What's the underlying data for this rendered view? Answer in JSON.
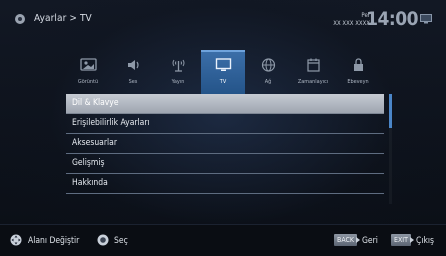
{
  "header": {
    "breadcrumb": "Ayarlar > TV",
    "day": "Per",
    "date": "XX XXX XXXX",
    "time": "14:00",
    "gear_icon": "gear-icon",
    "tv_icon": "tv-icon"
  },
  "tabs": [
    {
      "label": "Görüntü",
      "icon": "picture-icon",
      "active": false
    },
    {
      "label": "Ses",
      "icon": "speaker-icon",
      "active": false
    },
    {
      "label": "Yayın",
      "icon": "antenna-icon",
      "active": false
    },
    {
      "label": "TV",
      "icon": "tv-icon",
      "active": true
    },
    {
      "label": "Ağ",
      "icon": "globe-icon",
      "active": false
    },
    {
      "label": "Zamanlayıcı",
      "icon": "calendar-icon",
      "active": false
    },
    {
      "label": "Ebeveyn",
      "icon": "lock-icon",
      "active": false
    }
  ],
  "menu": {
    "items": [
      {
        "label": "Dil & Klavye",
        "selected": true
      },
      {
        "label": "Erişilebilirlik Ayarları",
        "selected": false
      },
      {
        "label": "Aksesuarlar",
        "selected": false
      },
      {
        "label": "Gelişmiş",
        "selected": false
      },
      {
        "label": "Hakkında",
        "selected": false
      }
    ]
  },
  "footer": {
    "navigate_label": "Alanı Değiştir",
    "ok_label": "Seç",
    "back_key": "BACK",
    "back_label": "Geri",
    "exit_key": "EXIT",
    "exit_label": "Çıkış"
  },
  "colors": {
    "accent": "#3b6ea8",
    "selected_row": "#b8bec7",
    "scrollbar": "#4b86c8"
  }
}
